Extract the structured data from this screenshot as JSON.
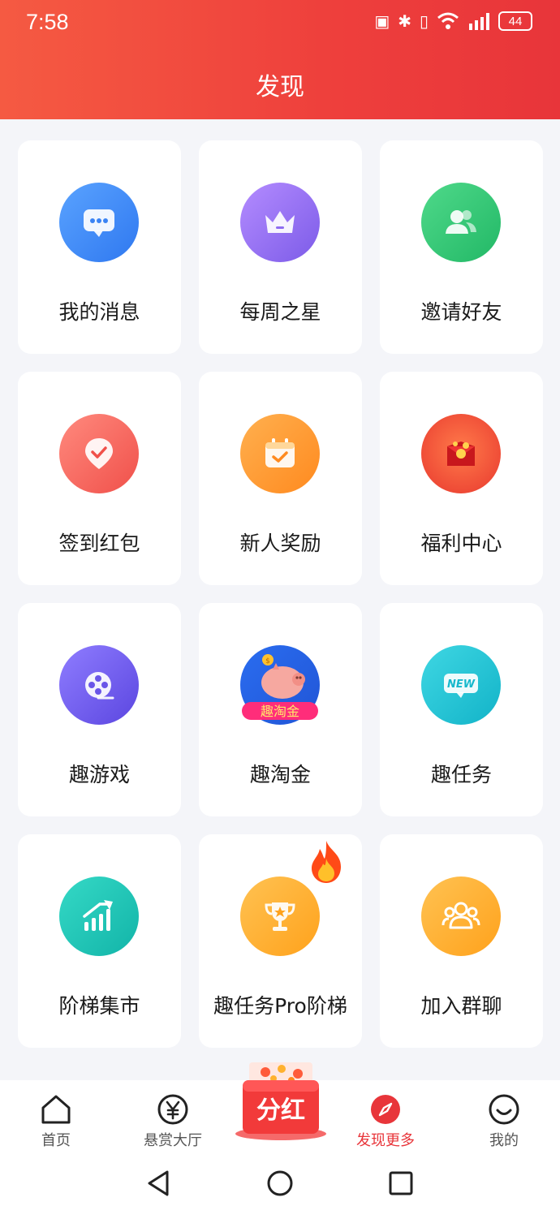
{
  "status_bar": {
    "time": "7:58",
    "battery": "44"
  },
  "header": {
    "title": "发现"
  },
  "grid": [
    {
      "label": "我的消息",
      "icon": "chat-icon"
    },
    {
      "label": "每周之星",
      "icon": "crown-icon"
    },
    {
      "label": "邀请好友",
      "icon": "users-icon"
    },
    {
      "label": "签到红包",
      "icon": "checkin-icon"
    },
    {
      "label": "新人奖励",
      "icon": "calendar-check-icon"
    },
    {
      "label": "福利中心",
      "icon": "red-envelope-icon"
    },
    {
      "label": "趣游戏",
      "icon": "film-reel-icon"
    },
    {
      "label": "趣淘金",
      "icon": "piggy-bank-icon",
      "badge_text": "趣淘金"
    },
    {
      "label": "趣任务",
      "icon": "new-badge-icon",
      "badge_text": "NEW"
    },
    {
      "label": "阶梯集市",
      "icon": "growth-chart-icon"
    },
    {
      "label": "趣任务Pro阶梯",
      "icon": "trophy-icon",
      "hot": "fire-icon"
    },
    {
      "label": "加入群聊",
      "icon": "group-icon"
    }
  ],
  "tabbar": {
    "tabs": [
      {
        "label": "首页",
        "icon": "home-icon"
      },
      {
        "label": "悬赏大厅",
        "icon": "yen-icon"
      },
      {
        "label": "发现更多",
        "icon": "compass-icon",
        "active": true
      },
      {
        "label": "我的",
        "icon": "smile-icon"
      }
    ],
    "center": {
      "label": "分红",
      "icon": "red-packet-icon"
    }
  },
  "colors": {
    "accent": "#e8353a",
    "header_start": "#f55a42",
    "header_end": "#e8353a"
  }
}
